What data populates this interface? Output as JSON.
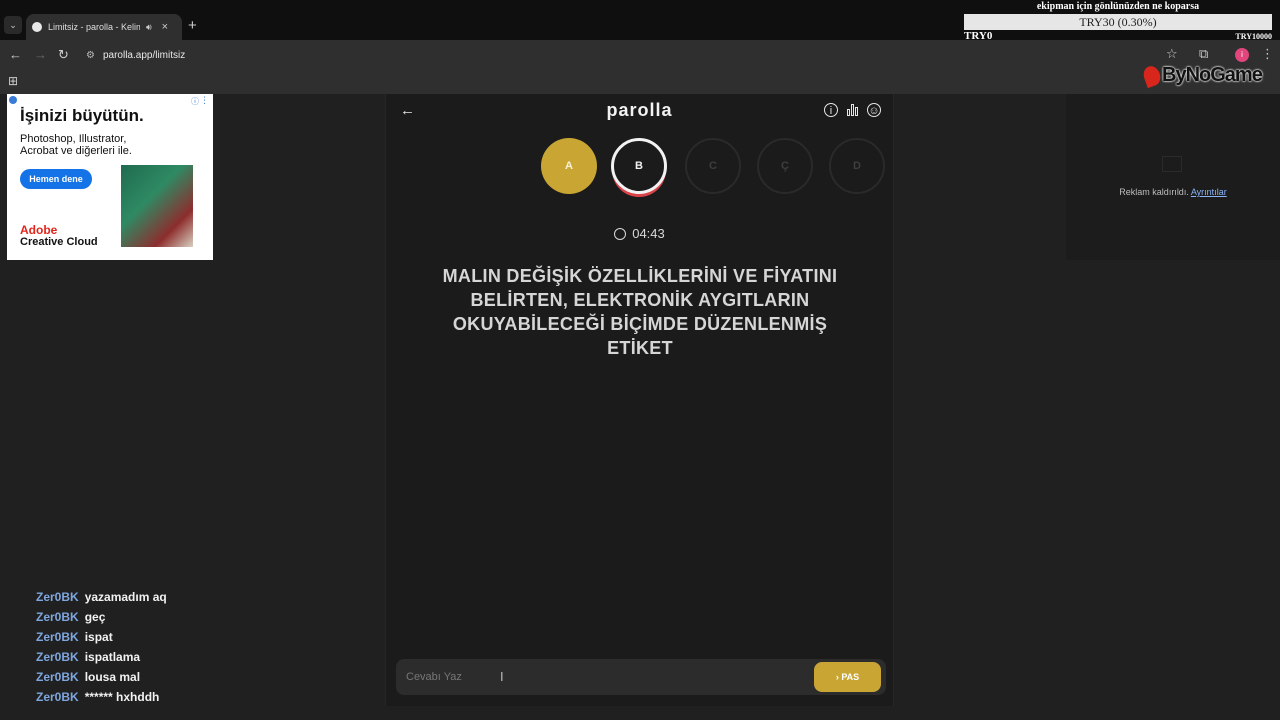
{
  "browser": {
    "tab_title": "Limitsiz - parolla - Kelime o",
    "new_tab": "+",
    "tab_list": "⌄",
    "tab_close": "×",
    "url": "parolla.app/limitsiz",
    "apps_icon": "apps-grid-icon"
  },
  "donation": {
    "goal_title": "ekipman için gönlünüzden ne koparsa",
    "progress_text": "TRY30 (0.30%)",
    "progress_fraction": 0.003,
    "min": "TRY0",
    "max": "TRY10000"
  },
  "stream_logo": "ByNoGame",
  "left_ad": {
    "headline": "İşinizi büyütün.",
    "body": "Photoshop, Illustrator, Acrobat ve diğerleri ile.",
    "cta": "Hemen dene",
    "brand_line1": "Adobe",
    "brand_line2": "Creative Cloud"
  },
  "right_ad": {
    "removed_text": "Reklam kaldırıldı.",
    "details_link": "Ayrıntılar"
  },
  "game": {
    "logo": "parolla",
    "letters": [
      {
        "label": "A",
        "state": "done"
      },
      {
        "label": "B",
        "state": "active"
      },
      {
        "label": "C",
        "state": "pending"
      },
      {
        "label": "Ç",
        "state": "pending"
      },
      {
        "label": "D",
        "state": "pending"
      }
    ],
    "timer": "04:43",
    "question": "MALIN DEĞİŞİK ÖZELLİKLERİNİ VE FİYATINI BELİRTEN, ELEKTRONİK AYGITLARIN OKUYABİLECEĞİ BİÇİMDE DÜZENLENMİŞ ETİKET",
    "answer_placeholder": "Cevabı Yaz",
    "pass_label": "› PAS",
    "colors": {
      "done": "#c9a634",
      "active_border": "#f2f2f2",
      "active_underline": "#d9434a",
      "pass": "#c9a634"
    }
  },
  "chat": [
    {
      "user": "Zer0BK",
      "message": "yazamadım aq"
    },
    {
      "user": "Zer0BK",
      "message": "geç"
    },
    {
      "user": "Zer0BK",
      "message": "ispat"
    },
    {
      "user": "Zer0BK",
      "message": "ispatlama"
    },
    {
      "user": "Zer0BK",
      "message": "lousa mal"
    },
    {
      "user": "Zer0BK",
      "message": "****** hxhddh"
    }
  ]
}
